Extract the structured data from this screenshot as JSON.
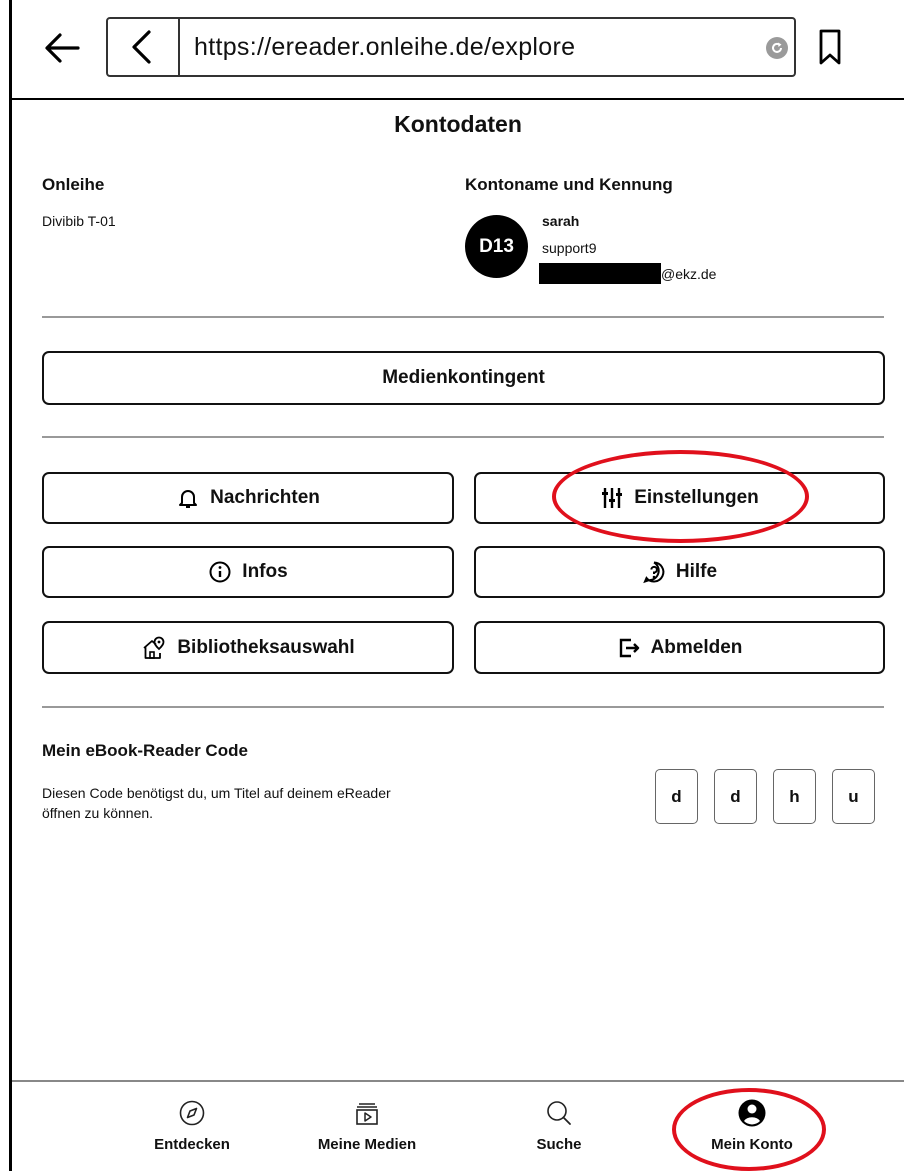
{
  "browser": {
    "url": "https://ereader.onleihe.de/explore"
  },
  "page": {
    "title": "Kontodaten"
  },
  "account": {
    "onleihe_label": "Onleihe",
    "library_name": "Divibib T-01",
    "account_label": "Kontoname und Kennung",
    "avatar_initials": "D13",
    "user_name": "sarah",
    "user_id": "support9",
    "email_suffix": "@ekz.de"
  },
  "buttons": {
    "media_quota": "Medienkontingent",
    "messages": "Nachrichten",
    "settings": "Einstellungen",
    "infos": "Infos",
    "help": "Hilfe",
    "library_select": "Bibliotheksauswahl",
    "logout": "Abmelden"
  },
  "reader_code": {
    "heading": "Mein eBook-Reader Code",
    "description_line1": "Diesen Code benötigst du, um Titel auf deinem eReader",
    "description_line2": "öffnen zu können.",
    "chars": [
      "d",
      "d",
      "h",
      "u"
    ]
  },
  "bottom_nav": [
    {
      "label": "Entdecken",
      "icon": "compass-icon"
    },
    {
      "label": "Meine Medien",
      "icon": "media-library-icon"
    },
    {
      "label": "Suche",
      "icon": "search-icon"
    },
    {
      "label": "Mein Konto",
      "icon": "account-icon",
      "active": true
    }
  ],
  "colors": {
    "annotation": "#e0101c",
    "text": "#111111",
    "divider": "#999999"
  }
}
